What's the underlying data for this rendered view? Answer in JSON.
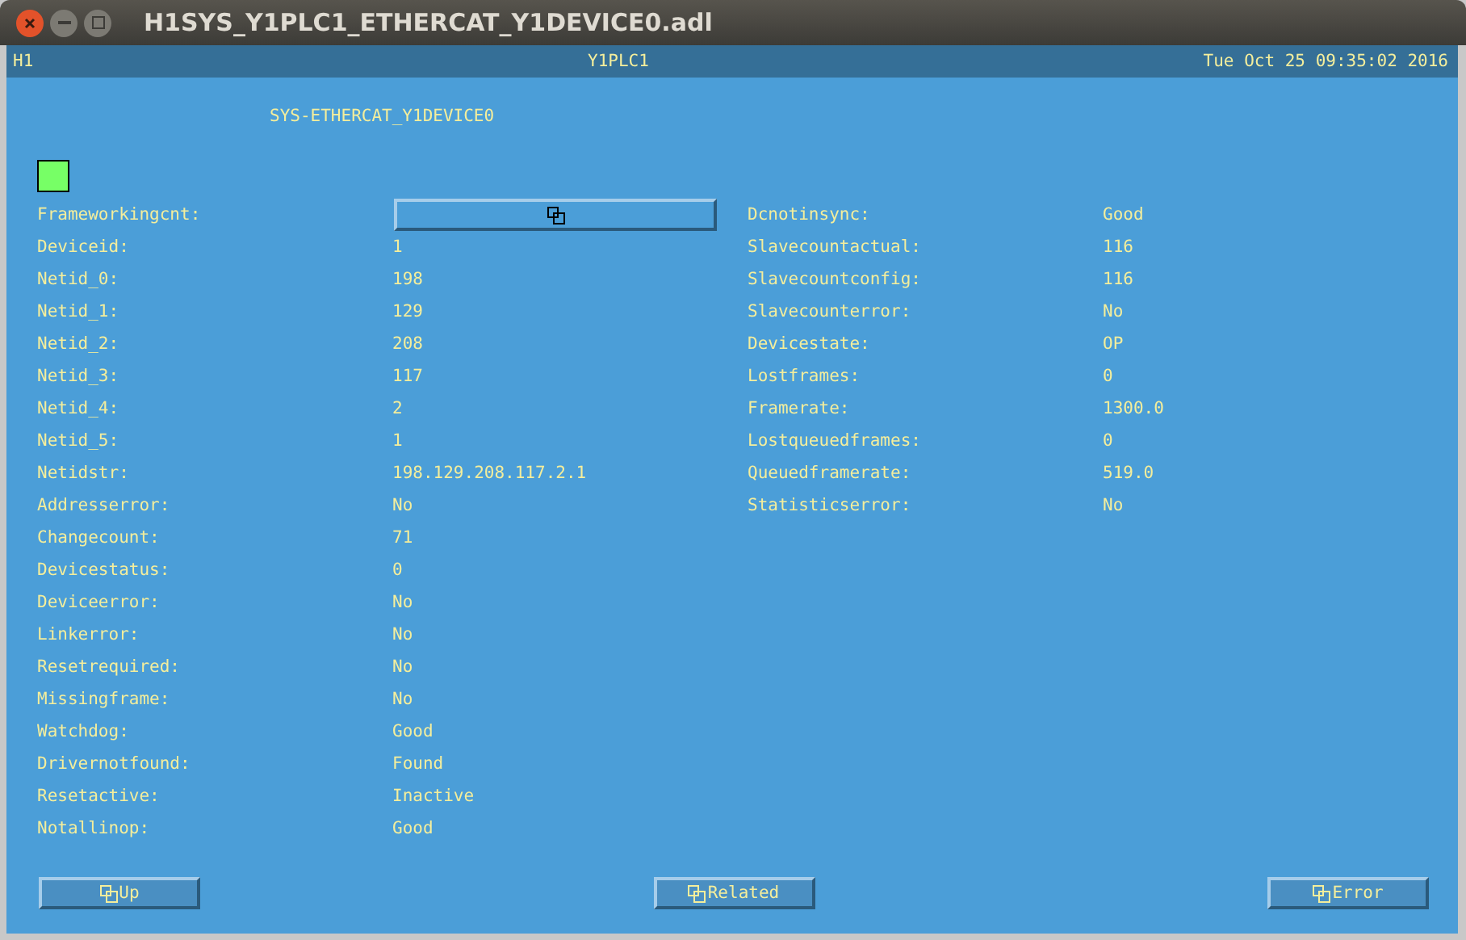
{
  "window": {
    "title": "H1SYS_Y1PLC1_ETHERCAT_Y1DEVICE0.adl"
  },
  "header": {
    "left": "H1",
    "center": "Y1PLC1",
    "right": "Tue Oct 25 09:35:02 2016"
  },
  "heading": "SYS-ETHERCAT_Y1DEVICE0",
  "status_indicator": {
    "color": "#77ff66"
  },
  "left_rows": [
    {
      "kind": "button",
      "label": "Frameworkingcnt:"
    },
    {
      "kind": "text",
      "label": "Deviceid:",
      "value": "1"
    },
    {
      "kind": "text",
      "label": "Netid_0:",
      "value": "198"
    },
    {
      "kind": "text",
      "label": "Netid_1:",
      "value": "129"
    },
    {
      "kind": "text",
      "label": "Netid_2:",
      "value": "208"
    },
    {
      "kind": "text",
      "label": "Netid_3:",
      "value": "117"
    },
    {
      "kind": "text",
      "label": "Netid_4:",
      "value": "2"
    },
    {
      "kind": "text",
      "label": "Netid_5:",
      "value": "1"
    },
    {
      "kind": "text",
      "label": "Netidstr:",
      "value": "198.129.208.117.2.1"
    },
    {
      "kind": "text",
      "label": "Addresserror:",
      "value": "No"
    },
    {
      "kind": "text",
      "label": "Changecount:",
      "value": "71"
    },
    {
      "kind": "text",
      "label": "Devicestatus:",
      "value": "0"
    },
    {
      "kind": "text",
      "label": "Deviceerror:",
      "value": "No"
    },
    {
      "kind": "text",
      "label": "Linkerror:",
      "value": "No"
    },
    {
      "kind": "text",
      "label": "Resetrequired:",
      "value": "No"
    },
    {
      "kind": "text",
      "label": "Missingframe:",
      "value": "No"
    },
    {
      "kind": "text",
      "label": "Watchdog:",
      "value": "Good"
    },
    {
      "kind": "text",
      "label": "Drivernotfound:",
      "value": "Found"
    },
    {
      "kind": "text",
      "label": "Resetactive:",
      "value": "Inactive"
    },
    {
      "kind": "text",
      "label": "Notallinop:",
      "value": "Good"
    }
  ],
  "right_rows": [
    {
      "kind": "text",
      "label": "Dcnotinsync:",
      "value": "Good"
    },
    {
      "kind": "text",
      "label": "Slavecountactual:",
      "value": "116"
    },
    {
      "kind": "text",
      "label": "Slavecountconfig:",
      "value": "116"
    },
    {
      "kind": "text",
      "label": "Slavecounterror:",
      "value": "No"
    },
    {
      "kind": "text",
      "label": "Devicestate:",
      "value": "OP"
    },
    {
      "kind": "text",
      "label": "Lostframes:",
      "value": "0"
    },
    {
      "kind": "text",
      "label": "Framerate:",
      "value": "1300.0"
    },
    {
      "kind": "text",
      "label": "Lostqueuedframes:",
      "value": "0"
    },
    {
      "kind": "text",
      "label": "Queuedframerate:",
      "value": "519.0"
    },
    {
      "kind": "text",
      "label": "Statisticserror:",
      "value": "No"
    }
  ],
  "buttons": [
    "Up",
    "Related",
    "Error"
  ]
}
